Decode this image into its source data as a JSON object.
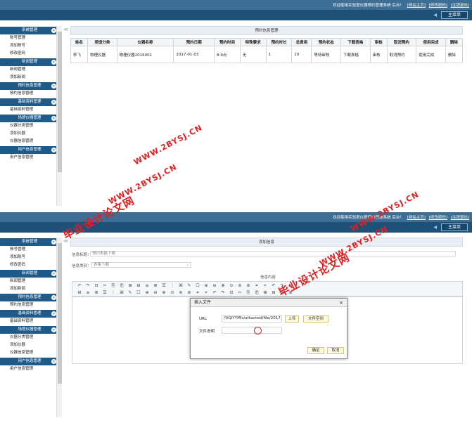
{
  "top": {
    "welcome": "欢迎使用实验室仪器预约管理系统 后台！",
    "home_link": "[网站主页]",
    "pwd_link": "[修改密码]",
    "logout_link": "[注销退出]",
    "main_menu": "主菜单"
  },
  "sidebar": {
    "sections": [
      {
        "title": "系统管理",
        "items": [
          "账号管理",
          "添加账号",
          "修改密码"
        ]
      },
      {
        "title": "新闻管理",
        "items": [
          "新闻管理",
          "添加新闻"
        ]
      },
      {
        "title": "预约信息管理",
        "items": [
          "预约信息管理"
        ]
      },
      {
        "title": "基础资料管理",
        "items": [
          "基础资料管理"
        ]
      },
      {
        "title": "场馆仪器管理",
        "items": [
          "仪器分类管理",
          "添加仪器",
          "仪器信息管理"
        ]
      },
      {
        "title": "用户信息管理",
        "items": [
          "用户信息管理"
        ]
      }
    ]
  },
  "screen1": {
    "title": "预约信息管理",
    "columns": [
      "姓名",
      "场馆分类",
      "仪器名称",
      "预约日期",
      "预约时间",
      "特殊要求",
      "预约时长",
      "总费用",
      "预约状态",
      "下载表格",
      "审核",
      "取消预约",
      "使用完成",
      "删除"
    ],
    "row": [
      "李飞",
      "物理仪器",
      "物理仪器2016001",
      "2017-01-03",
      "8-9点",
      "无",
      "1",
      "20",
      "等待审核",
      "下载表格",
      "审核",
      "取消预约",
      "使用完成",
      "删除"
    ]
  },
  "screen2": {
    "title": "添加信息",
    "info_title_label": "信息标题：",
    "info_title_value": "预约表格下载",
    "info_type_label": "信息类别：",
    "info_type_value": "表格下载",
    "content_label": "信息内容",
    "dialog": {
      "title": "插入文件",
      "close": "×",
      "url_label": "URL",
      "url_value": "/YiQiYYMIs/attached/file/2017",
      "upload_btn": "上传",
      "space_btn": "文件空间",
      "desc_label": "文件说明",
      "ok_btn": "确定",
      "cancel_btn": "取消"
    }
  },
  "watermarks": {
    "cn": "毕业设计论文网",
    "url": "WWW.2BYSJ.CN"
  },
  "colors": {
    "topbar": "#3d6e96",
    "subbar": "#1f5178",
    "sidebar_head": "#1f5a89",
    "watermark": "#e02020"
  }
}
